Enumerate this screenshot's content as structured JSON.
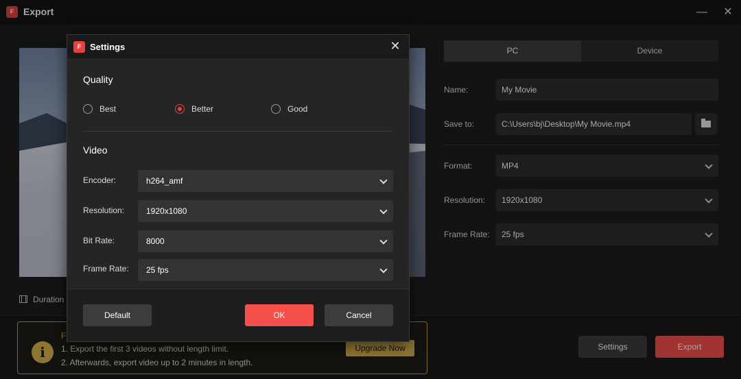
{
  "window": {
    "title": "Export",
    "logo_text": "F"
  },
  "preview": {
    "duration_label": "Duration"
  },
  "export_panel": {
    "tabs": [
      {
        "label": "PC"
      },
      {
        "label": "Device"
      }
    ],
    "name": {
      "label": "Name:",
      "value": "My Movie"
    },
    "save_to": {
      "label": "Save to:",
      "value": "C:\\Users\\bj\\Desktop\\My Movie.mp4"
    },
    "format": {
      "label": "Format:",
      "value": "MP4"
    },
    "resolution": {
      "label": "Resolution:",
      "value": "1920x1080"
    },
    "frame_rate": {
      "label": "Frame Rate:",
      "value": "25 fps"
    }
  },
  "notice": {
    "title_initial": "F",
    "lines": [
      "1. Export the first 3 videos without length limit.",
      "2. Afterwards, export video up to 2 minutes in length."
    ],
    "upgrade_label": "Upgrade Now"
  },
  "bottom_buttons": {
    "settings_label": "Settings",
    "export_label": "Export"
  },
  "settings_dialog": {
    "title": "Settings",
    "quality": {
      "title": "Quality",
      "options": [
        {
          "label": "Best",
          "checked": false
        },
        {
          "label": "Better",
          "checked": true
        },
        {
          "label": "Good",
          "checked": false
        }
      ]
    },
    "video": {
      "title": "Video",
      "encoder": {
        "label": "Encoder:",
        "value": "h264_amf"
      },
      "resolution": {
        "label": "Resolution:",
        "value": "1920x1080"
      },
      "bit_rate": {
        "label": "Bit Rate:",
        "value": "8000"
      },
      "frame_rate": {
        "label": "Frame Rate:",
        "value": "25 fps"
      }
    },
    "buttons": {
      "default_label": "Default",
      "ok_label": "OK",
      "cancel_label": "Cancel"
    }
  },
  "colors": {
    "accent": "#f5504b",
    "notice_border": "#c9a227",
    "upgrade": "#d9b24c"
  },
  "icons": [
    "app-logo-icon",
    "minimize-icon",
    "close-icon",
    "folder-icon",
    "chevron-down-icon",
    "film-icon",
    "info-icon"
  ]
}
